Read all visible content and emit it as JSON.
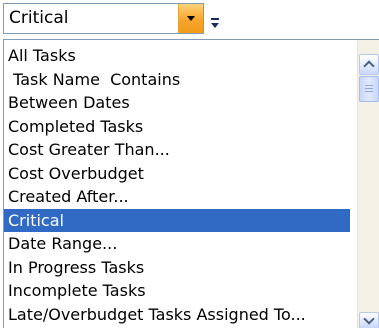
{
  "combo": {
    "value": "Critical",
    "button_icon": "dropdown-arrow-icon",
    "grip_icon": "toolbar-options-icon"
  },
  "list": {
    "items": [
      {
        "label": "All Tasks"
      },
      {
        "label": " Task Name  Contains"
      },
      {
        "label": "Between Dates"
      },
      {
        "label": "Completed Tasks"
      },
      {
        "label": "Cost Greater Than..."
      },
      {
        "label": "Cost Overbudget"
      },
      {
        "label": "Created After..."
      },
      {
        "label": "Critical"
      },
      {
        "label": "Date Range..."
      },
      {
        "label": "In Progress Tasks"
      },
      {
        "label": "Incomplete Tasks"
      },
      {
        "label": "Late/Overbudget Tasks Assigned To..."
      }
    ],
    "selected_label": "Critical"
  },
  "colors": {
    "selection": "#316ac5",
    "combo_button": "#f7a52e",
    "border": "#7f9db9"
  }
}
